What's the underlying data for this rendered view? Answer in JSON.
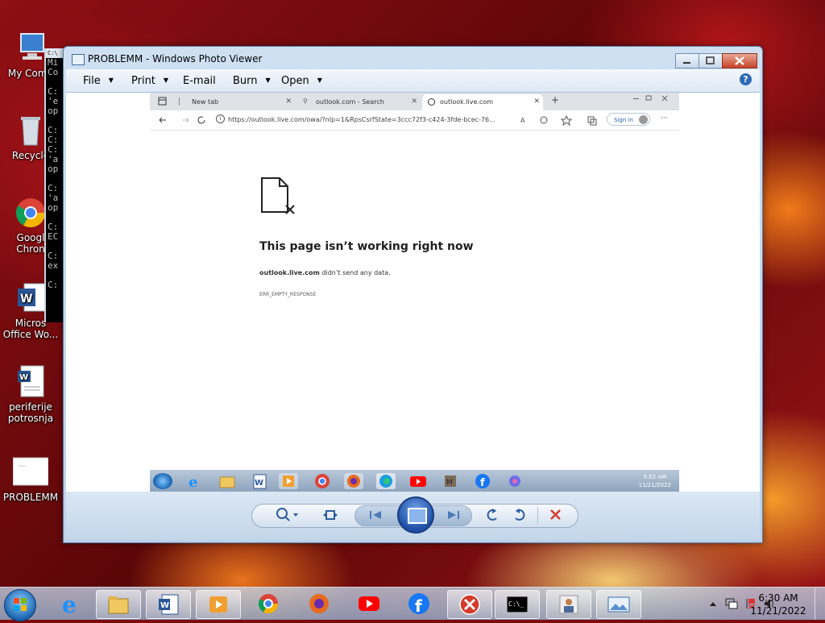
{
  "desktop": {
    "icons": [
      {
        "label": "My Comp"
      },
      {
        "label": "Recycle"
      },
      {
        "label": "Googl\nChron"
      },
      {
        "label": "Micros\nOffice Wo..."
      },
      {
        "label": "periferije\npotrosnja"
      },
      {
        "label": "PROBLEMM"
      }
    ]
  },
  "cmd": {
    "lines": [
      "Mi",
      "Co",
      "",
      "C:",
      "'e",
      "op",
      "",
      "C:",
      "C:",
      "C:",
      "'a",
      "op",
      "",
      "C:",
      "'a",
      "op",
      "",
      "C:",
      "EC",
      "",
      "C:",
      "ex",
      "",
      "C:"
    ]
  },
  "photo_viewer": {
    "title": "PROBLEMM - Windows Photo Viewer",
    "menu": {
      "file": "File",
      "print": "Print",
      "email": "E-mail",
      "burn": "Burn",
      "open": "Open"
    },
    "help": "?"
  },
  "screenshot": {
    "tabs": [
      {
        "label": "New tab"
      },
      {
        "label": "outlook.com - Search"
      },
      {
        "label": "outlook.live.com"
      }
    ],
    "url": "https://outlook.live.com/owa/?nlp=1&RpsCsrfState=3ccc72f3-c424-3fde-bcec-76...",
    "signin": "Sign in",
    "error": {
      "title": "This page isn’t working right now",
      "host": "outlook.live.com",
      "message": " didn’t send any data.",
      "code": "ERR_EMPTY_RESPONSE"
    },
    "clock": {
      "time": "5:52 AM",
      "date": "11/21/2022"
    }
  },
  "taskbar": {
    "clock": {
      "time": "6:30 AM",
      "date": "11/21/2022"
    }
  },
  "colors": {
    "accent": "#2d5da1",
    "close_red": "#c7432b",
    "youtube": "#ff0000",
    "facebook": "#1877f2"
  }
}
